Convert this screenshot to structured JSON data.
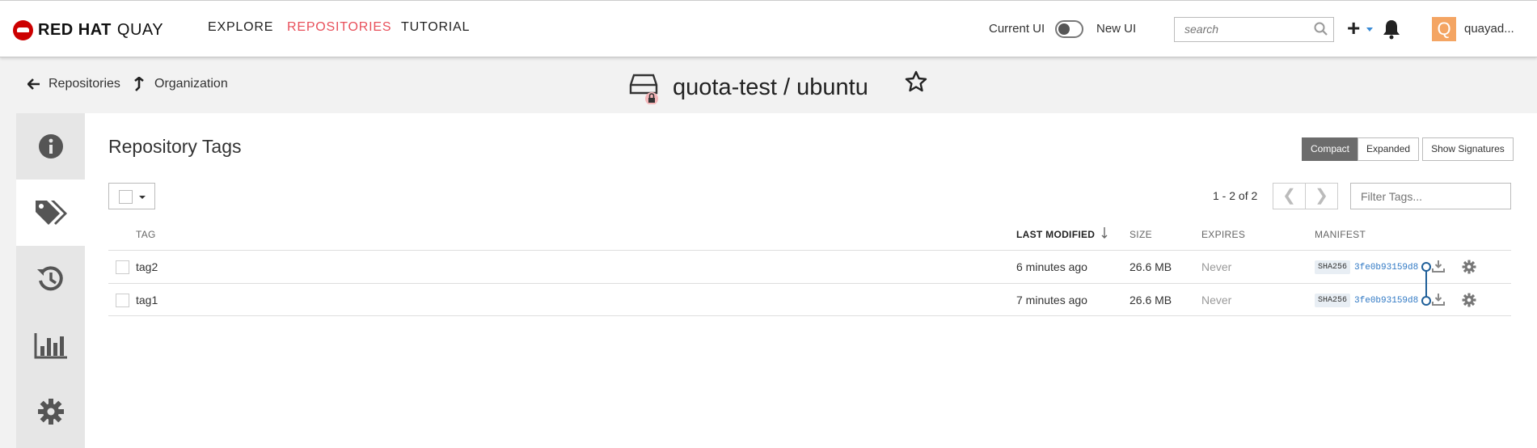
{
  "navbar": {
    "brand_bold": "RED HAT",
    "brand_light": "QUAY",
    "links": [
      "EXPLORE",
      "REPOSITORIES",
      "TUTORIAL"
    ],
    "current_ui_label": "Current UI",
    "new_ui_label": "New UI",
    "search_placeholder": "search",
    "avatar_letter": "Q",
    "username": "quayad..."
  },
  "header": {
    "back_repositories": "Repositories",
    "back_organization": "Organization",
    "repo_name": "quota-test / ubuntu"
  },
  "sidebar": {
    "items": [
      "info-icon",
      "tags-icon",
      "history-icon",
      "usage-logs-icon",
      "settings-icon"
    ],
    "active_index": 1
  },
  "main": {
    "title": "Repository Tags",
    "view_modes": [
      "Compact",
      "Expanded"
    ],
    "active_view": "Compact",
    "show_signatures_label": "Show Signatures",
    "page_count": "1 - 2 of 2",
    "prev_symbol": "❮",
    "next_symbol": "❯",
    "filter_placeholder": "Filter Tags...",
    "columns": {
      "tag": "TAG",
      "last_modified": "LAST MODIFIED",
      "size": "SIZE",
      "expires": "EXPIRES",
      "manifest": "MANIFEST"
    },
    "rows": [
      {
        "tag": "tag2",
        "last_modified": "6 minutes ago",
        "size": "26.6 MB",
        "expires": "Never",
        "algo": "SHA256",
        "digest": "3fe0b93159d8"
      },
      {
        "tag": "tag1",
        "last_modified": "7 minutes ago",
        "size": "26.6 MB",
        "expires": "Never",
        "algo": "SHA256",
        "digest": "3fe0b93159d8"
      }
    ]
  },
  "colors": {
    "accent_red": "#e8505b",
    "link_blue": "#2f78c4",
    "manifest_line": "#1f5f99",
    "avatar_bg": "#f4a563"
  }
}
